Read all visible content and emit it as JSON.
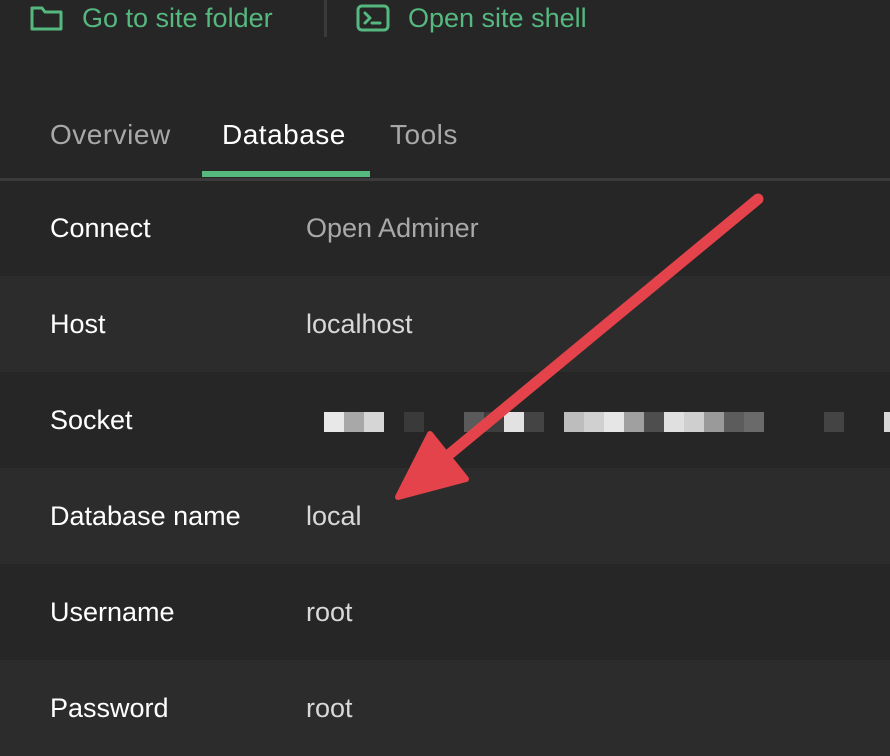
{
  "actions": {
    "folder": {
      "label": "Go to site folder",
      "icon": "folder-icon"
    },
    "shell": {
      "label": "Open site shell",
      "icon": "terminal-icon"
    }
  },
  "tabs": [
    {
      "label": "Overview",
      "active": false
    },
    {
      "label": "Database",
      "active": true
    },
    {
      "label": "Tools",
      "active": false
    }
  ],
  "rows": [
    {
      "label": "Connect",
      "value": "Open Adminer"
    },
    {
      "label": "Host",
      "value": "localhost"
    },
    {
      "label": "Socket",
      "value": ""
    },
    {
      "label": "Database name",
      "value": "local"
    },
    {
      "label": "Username",
      "value": "root"
    },
    {
      "label": "Password",
      "value": "root"
    }
  ],
  "colors": {
    "accent": "#55b87f",
    "background": "#262626",
    "row_alt": "#2c2c2c",
    "arrow": "#e5434b"
  }
}
